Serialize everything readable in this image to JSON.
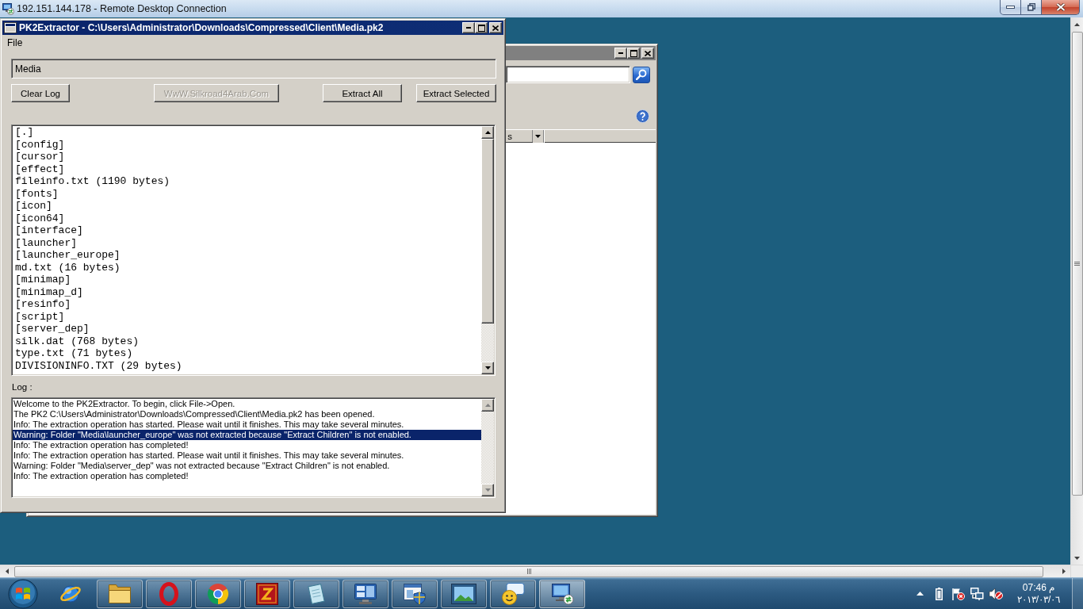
{
  "remote_desktop_window": {
    "title": "192.151.144.178 - Remote Desktop Connection"
  },
  "background_window": {
    "columns": [
      {
        "label": "s"
      }
    ]
  },
  "pk2_window": {
    "title": "PK2Extractor - C:\\Users\\Administrator\\Downloads\\Compressed\\Client\\Media.pk2",
    "menu": [
      "File"
    ],
    "path_field": {
      "value": "Media"
    },
    "buttons": [
      {
        "label": "Clear Log",
        "disabled": false
      },
      {
        "label": "WwW.Silkroad4Arab.Com",
        "disabled": true
      },
      {
        "label": "Extract All",
        "disabled": false
      },
      {
        "label": "Extract Selected",
        "disabled": false
      }
    ],
    "file_list": [
      "[.]",
      "[config]",
      "[cursor]",
      "[effect]",
      "fileinfo.txt (1190 bytes)",
      "[fonts]",
      "[icon]",
      "[icon64]",
      "[interface]",
      "[launcher]",
      "[launcher_europe]",
      "md.txt (16 bytes)",
      "[minimap]",
      "[minimap_d]",
      "[resinfo]",
      "[script]",
      "[server_dep]",
      "silk.dat (768 bytes)",
      "type.txt (71 bytes)",
      "DIVISIONINFO.TXT (29 bytes)"
    ],
    "log_label": "Log :",
    "log_lines": [
      {
        "text": "Welcome to the PK2Extractor. To begin, click File->Open.",
        "selected": false
      },
      {
        "text": "The PK2 C:\\Users\\Administrator\\Downloads\\Compressed\\Client\\Media.pk2 has been opened.",
        "selected": false
      },
      {
        "text": "Info: The extraction operation has started. Please wait until it finishes. This may take several minutes.",
        "selected": false
      },
      {
        "text": "Warning: Folder \"Media\\launcher_europe\" was not extracted because \"Extract Children\" is not enabled.",
        "selected": true
      },
      {
        "text": "Info: The extraction operation has completed!",
        "selected": false
      },
      {
        "text": "Info: The extraction operation has started. Please wait until it finishes. This may take several minutes.",
        "selected": false
      },
      {
        "text": "Warning: Folder \"Media\\server_dep\" was not extracted because \"Extract Children\" is not enabled.",
        "selected": false
      },
      {
        "text": "Info: The extraction operation has completed!",
        "selected": false
      }
    ]
  },
  "taskbar": {
    "apps": [
      {
        "kind": "globe",
        "running": false,
        "selected": false
      },
      {
        "kind": "folder",
        "running": true,
        "selected": false
      },
      {
        "kind": "ring",
        "running": true,
        "selected": false
      },
      {
        "kind": "segments",
        "running": true,
        "selected": false
      },
      {
        "kind": "zigzag",
        "running": true,
        "selected": false
      },
      {
        "kind": "notepad",
        "running": true,
        "selected": false
      },
      {
        "kind": "panels",
        "running": true,
        "selected": false
      },
      {
        "kind": "shield_window",
        "running": true,
        "selected": false
      },
      {
        "kind": "picture",
        "running": true,
        "selected": false
      },
      {
        "kind": "chat",
        "running": true,
        "selected": false
      },
      {
        "kind": "remote",
        "running": true,
        "selected": true
      }
    ],
    "tray": {
      "volume_muted": true
    },
    "clock": {
      "time": "07:46 م",
      "date": "٢٠١٣/٠٣/٠٦"
    }
  }
}
